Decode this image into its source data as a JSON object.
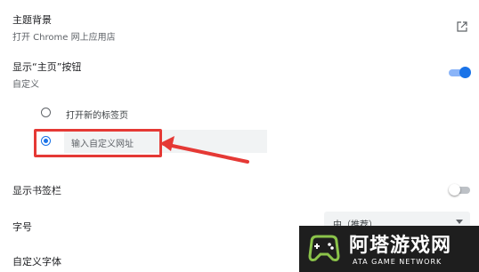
{
  "theme": {
    "title": "主题背景",
    "subtitle": "打开 Chrome 网上应用店"
  },
  "home_button": {
    "title": "显示“主页”按钮",
    "subtitle": "自定义",
    "enabled": true,
    "options": [
      {
        "label": "打开新的标签页",
        "selected": false
      },
      {
        "label": "输入自定义网址",
        "selected": true
      }
    ]
  },
  "bookmarks_bar": {
    "title": "显示书签栏",
    "enabled": false
  },
  "font_size": {
    "title": "字号",
    "selected": "中（推荐）"
  },
  "custom_fonts": {
    "title": "自定义字体"
  },
  "watermark": {
    "name": "阿塔游戏网",
    "subtitle": "ATA GAME NETWORK"
  },
  "colors": {
    "accent": "#1a73e8",
    "annotation": "#e53935",
    "watermark_bg": "#1e1e1e",
    "watermark_green": "#8bc34a"
  }
}
